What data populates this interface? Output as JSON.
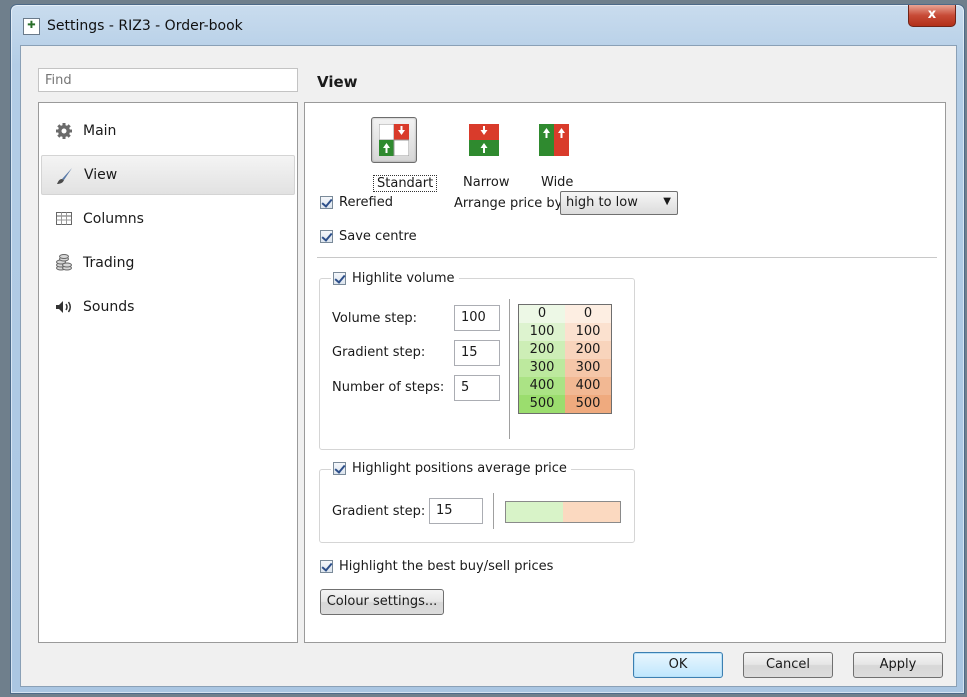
{
  "window": {
    "title": "Settings - RIZ3 - Order-book",
    "close_glyph": "x"
  },
  "sidebar": {
    "search_placeholder": "Find",
    "items": [
      {
        "label": "Main",
        "icon": "gear-icon"
      },
      {
        "label": "View",
        "icon": "brush-icon",
        "selected": true
      },
      {
        "label": "Columns",
        "icon": "table-icon"
      },
      {
        "label": "Trading",
        "icon": "coins-icon"
      },
      {
        "label": "Sounds",
        "icon": "speaker-icon"
      }
    ]
  },
  "main": {
    "section_title": "View",
    "layout_presets": [
      {
        "label": "Standart",
        "selected": true
      },
      {
        "label": "Narrow",
        "selected": false
      },
      {
        "label": "Wide",
        "selected": false
      }
    ],
    "rerefied": {
      "label": "Rerefied",
      "checked": true
    },
    "arrange": {
      "label": "Arrange price by",
      "value": "high to low"
    },
    "save_centre": {
      "label": "Save centre",
      "checked": true
    },
    "highlite_volume": {
      "label": "Highlite volume",
      "checked": true,
      "volume_step_label": "Volume step:",
      "volume_step_value": "100",
      "gradient_step_label": "Gradient step:",
      "gradient_step_value": "15",
      "number_of_steps_label": "Number of steps:",
      "number_of_steps_value": "5",
      "gradient_rows": [
        [
          "0",
          "0"
        ],
        [
          "100",
          "100"
        ],
        [
          "200",
          "200"
        ],
        [
          "300",
          "300"
        ],
        [
          "400",
          "400"
        ],
        [
          "500",
          "500"
        ]
      ],
      "buy_colors": [
        "#edf8e6",
        "#ddf3cf",
        "#cdeeb6",
        "#bde99e",
        "#abe385",
        "#9bdd6e"
      ],
      "sell_colors": [
        "#fdeee2",
        "#fbe1cf",
        "#f8d4bc",
        "#f5c6a8",
        "#f2b893",
        "#efaa7e"
      ]
    },
    "avg_price": {
      "label": "Highlight positions average price",
      "checked": true,
      "gradient_step_label": "Gradient step:",
      "gradient_step_value": "15",
      "buy_color": "#d8f3c8",
      "sell_color": "#fbd9c0"
    },
    "best_prices": {
      "label": "Highlight the best buy/sell prices",
      "checked": true
    },
    "colour_settings_label": "Colour settings..."
  },
  "footer": {
    "ok_label": "OK",
    "cancel_label": "Cancel",
    "apply_label": "Apply"
  }
}
